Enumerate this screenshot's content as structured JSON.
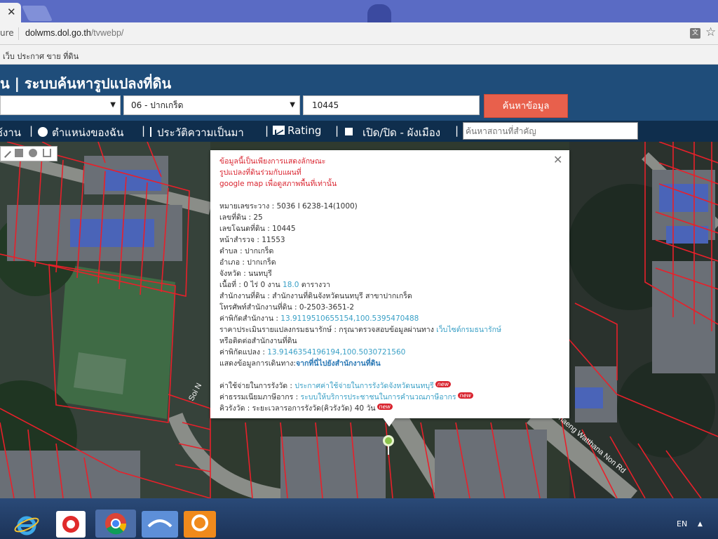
{
  "browser": {
    "secure_label": "ure",
    "url_host": "dolwms.dol.go.th",
    "url_path": "/tvwebp/",
    "bookmark": "เว็บ ประกาศ ขาย ที่ดิน"
  },
  "header": {
    "title": "น | ระบบค้นหารูปแปลงที่ดิน"
  },
  "search": {
    "amphur": "06 - ปากเกร็ด",
    "parcel_number": "10445",
    "button": "ค้นหาข้อมูล",
    "landmark_placeholder": "ค้นหาสถานที่สำคัญ"
  },
  "menu": {
    "item1": "วิธีใช้งาน",
    "item2": "ตำแหน่งของฉัน",
    "item3": "ประวัติความเป็นมา",
    "item4": "Rating",
    "item5": "เปิด/ปิด - ผังเมือง"
  },
  "map_labels": {
    "soi": "Soi N",
    "road": "Chaeng Watthana Non Rd"
  },
  "popup": {
    "notice_line1": "ข้อมูลนี้เป็นเพียงการแสดงลักษณะ",
    "notice_line2": "รูปแปลงที่ดินร่วมกับแผนที่",
    "notice_line3": "google map เพื่อดูสภาพพื้นที่เท่านั้น",
    "map_sheet": "หมายเลขระวาง : 5036 I 6238-14(1000)",
    "land_no": "เลขที่ดิน : 25",
    "deed_no": "เลขโฉนดที่ดิน : 10445",
    "survey_page": "หน้าสำรวจ : 11553",
    "tambon": "ตำบล : ปากเกร็ด",
    "amphoe": "อำเภอ : ปากเกร็ด",
    "province": "จังหวัด : นนทบุรี",
    "area_prefix": "เนื้อที่ : 0 ไร่ 0 งาน ",
    "area_value": "18.0",
    "area_suffix": " ตารางวา",
    "office": "สำนักงานที่ดิน : สำนักงานที่ดินจังหวัดนนทบุรี สาขาปากเกร็ด",
    "phone": "โทรศัพท์สำนักงานที่ดิน : 0-2503-3651-2",
    "office_coord_label": "ค่าพิกัดสำนักงาน : ",
    "office_coord_value": "13.9119510655154,100.5395470488",
    "price_label": "ราคาประเมินรายแปลงกรมธนารักษ์ : กรุณาตรวจสอบข้อมูลผ่านทาง ",
    "price_link": "เว็บไซต์กรมธนารักษ์",
    "price_cont": "หรือติดต่อสำนักงานที่ดิน",
    "parcel_coord_label": "ค่าพิกัดแปลง : ",
    "parcel_coord_value": "13.9146354196194,100.5030721560",
    "route_label": "แสดงข้อมูลการเดินทาง:",
    "route_link": "จากที่นี่ไปยังสำนักงานที่ดิน",
    "fee_label": "ค่าใช้จ่ายในการรังวัด : ",
    "fee_link": "ประกาศค่าใช้จ่ายในการรังวัดจังหวัดนนทบุรี",
    "tax_label": "ค่าธรรมเนียมภาษีอากร : ",
    "tax_link": "ระบบให้บริการประชาชนในการคำนวณภาษีอากร",
    "queue_label": "คิวรังวัด : ระยะเวลารอการรังวัด(คิวรังวัด) 40 วัน",
    "new_badge": "new"
  },
  "taskbar": {
    "lang": "EN"
  },
  "colors": {
    "header": "#1f4d7a",
    "menubar": "#0f2e4d",
    "search_button": "#e8604c",
    "parcel_line": "#e8202a",
    "notice_red": "#d9242f",
    "link": "#3aa0c6"
  }
}
